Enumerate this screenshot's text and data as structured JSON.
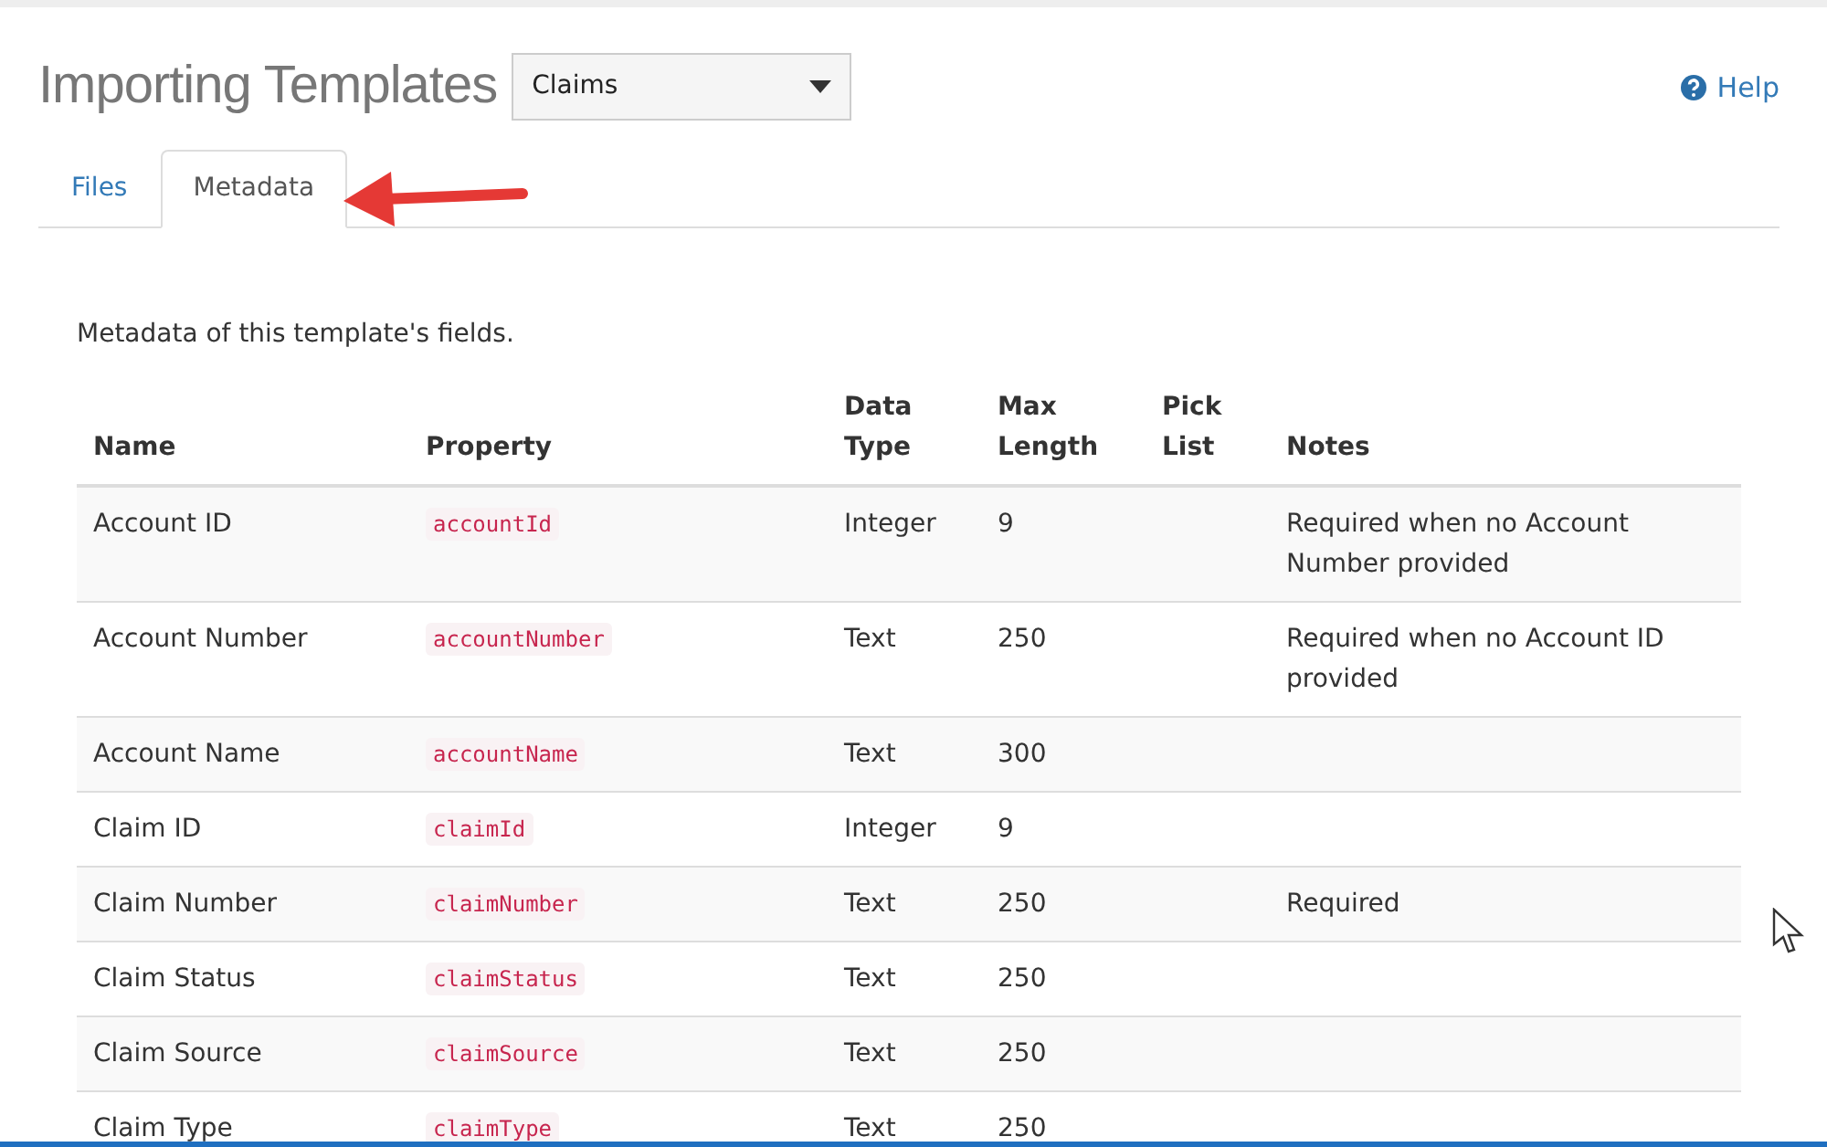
{
  "title": "Importing Templates",
  "template_select": {
    "value": "Claims"
  },
  "help": {
    "label": "Help"
  },
  "tabs": [
    {
      "label": "Files",
      "selected": false
    },
    {
      "label": "Metadata",
      "selected": true
    }
  ],
  "description": "Metadata of this template's fields.",
  "table": {
    "columns": [
      "Name",
      "Property",
      "Data\nType",
      "Max\nLength",
      "Pick\nList",
      "Notes"
    ],
    "rows": [
      {
        "name": "Account ID",
        "property": "accountId",
        "data_type": "Integer",
        "max_length": "9",
        "pick_list": "",
        "notes": "Required when no Account Number provided"
      },
      {
        "name": "Account Number",
        "property": "accountNumber",
        "data_type": "Text",
        "max_length": "250",
        "pick_list": "",
        "notes": "Required when no Account ID provided"
      },
      {
        "name": "Account Name",
        "property": "accountName",
        "data_type": "Text",
        "max_length": "300",
        "pick_list": "",
        "notes": ""
      },
      {
        "name": "Claim ID",
        "property": "claimId",
        "data_type": "Integer",
        "max_length": "9",
        "pick_list": "",
        "notes": ""
      },
      {
        "name": "Claim Number",
        "property": "claimNumber",
        "data_type": "Text",
        "max_length": "250",
        "pick_list": "",
        "notes": "Required"
      },
      {
        "name": "Claim Status",
        "property": "claimStatus",
        "data_type": "Text",
        "max_length": "250",
        "pick_list": "",
        "notes": ""
      },
      {
        "name": "Claim Source",
        "property": "claimSource",
        "data_type": "Text",
        "max_length": "250",
        "pick_list": "",
        "notes": ""
      },
      {
        "name": "Claim Type",
        "property": "claimType",
        "data_type": "Text",
        "max_length": "250",
        "pick_list": "",
        "notes": ""
      }
    ]
  }
}
